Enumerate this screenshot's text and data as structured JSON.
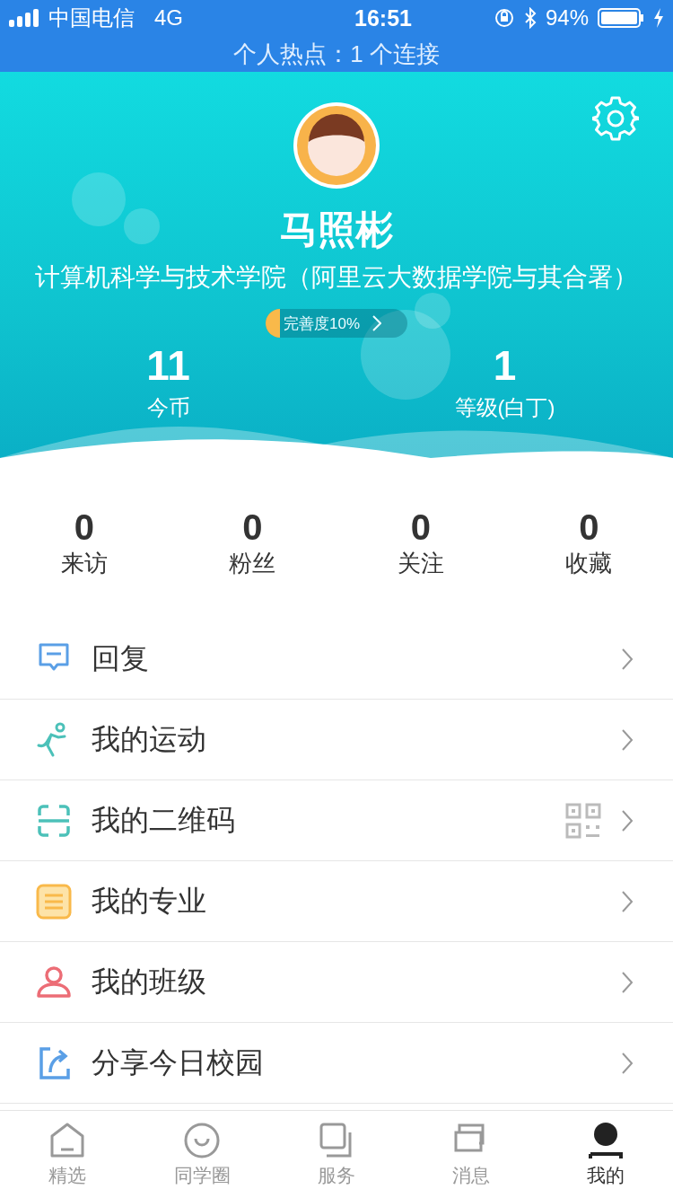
{
  "status_bar": {
    "carrier": "中国电信",
    "network": "4G",
    "time": "16:51",
    "battery": "94%"
  },
  "hotspot_banner": "个人热点：1 个连接",
  "profile": {
    "name": "马照彬",
    "college": "计算机科学与技术学院（阿里云大数据学院与其合署）",
    "completeness": {
      "label": "完善度10%",
      "level": 0.1
    },
    "stats": [
      {
        "value": "11",
        "label": "今币"
      },
      {
        "value": "1",
        "label": "等级(白丁)"
      }
    ]
  },
  "counters": [
    {
      "value": "0",
      "label": "来访"
    },
    {
      "value": "0",
      "label": "粉丝"
    },
    {
      "value": "0",
      "label": "关注"
    },
    {
      "value": "0",
      "label": "收藏"
    }
  ],
  "menu": [
    {
      "kind": "reply",
      "label": "回复",
      "qr": false
    },
    {
      "kind": "sport",
      "label": "我的运动",
      "qr": false
    },
    {
      "kind": "scan",
      "label": "我的二维码",
      "qr": true
    },
    {
      "kind": "major",
      "label": "我的专业",
      "qr": false
    },
    {
      "kind": "class",
      "label": "我的班级",
      "qr": false
    },
    {
      "kind": "share",
      "label": "分享今日校园",
      "qr": false
    }
  ],
  "tab_bar": [
    {
      "kind": "home",
      "label": "精选",
      "selected": false
    },
    {
      "kind": "circle",
      "label": "同学圈",
      "selected": false
    },
    {
      "kind": "service",
      "label": "服务",
      "selected": false
    },
    {
      "kind": "message",
      "label": "消息",
      "selected": false
    },
    {
      "kind": "me",
      "label": "我的",
      "selected": true
    }
  ]
}
